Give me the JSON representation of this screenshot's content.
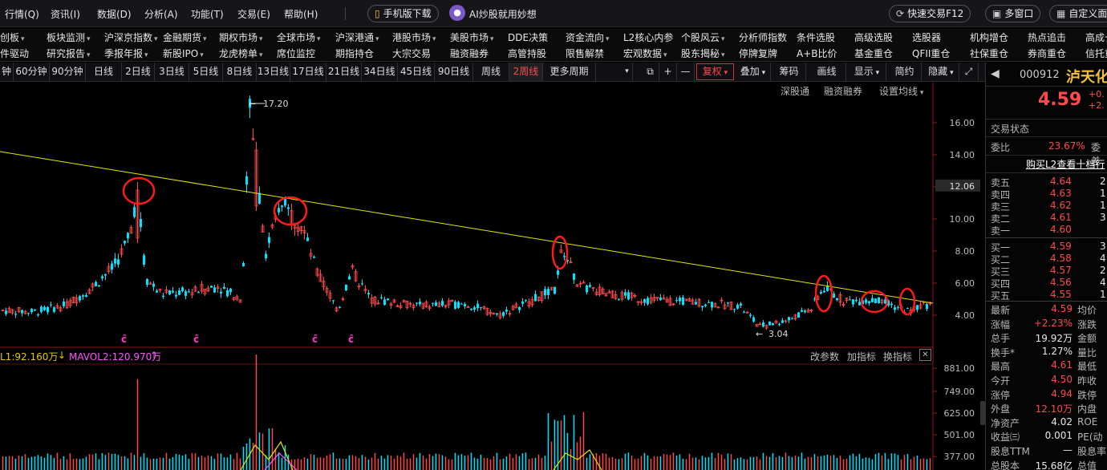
{
  "menu": {
    "items": [
      "行情(Q)",
      "资讯(I)",
      "数据(D)",
      "分析(A)",
      "功能(T)",
      "交易(E)",
      "帮助(H)"
    ],
    "mobile_download": "手机版下载",
    "ai_promo": "AI炒股就用妙想",
    "quick_trade": "快速交易F12",
    "multi_window": "多窗口",
    "custom": "自定义面"
  },
  "modules": {
    "row1": [
      "创板",
      "板块监测",
      "沪深京指数",
      "金融期货",
      "期权市场",
      "全球市场",
      "沪深港通",
      "港股市场",
      "美股市场",
      "DDE决策",
      "资金流向",
      "L2核心内参",
      "个股风云",
      "分析师指数",
      "条件选股",
      "高级选股",
      "选股器",
      "机构增仓",
      "热点追击",
      "高成长"
    ],
    "row2": [
      "件驱动",
      "研究报告",
      "季报年报",
      "新股IPO",
      "龙虎榜单",
      "席位监控",
      "期指持仓",
      "大宗交易",
      "融资融券",
      "高管持股",
      "限售解禁",
      "宏观数据",
      "股东揭秘",
      "停牌复牌",
      "A+B比价",
      "基金重仓",
      "QFII重仓",
      "社保重仓",
      "券商重仓",
      "信托重"
    ]
  },
  "periods": [
    "钟",
    "60分钟",
    "90分钟",
    "日线",
    "2日线",
    "3日线",
    "5日线",
    "8日线",
    "13日线",
    "17日线",
    "21日线",
    "34日线",
    "45日线",
    "90日线",
    "周线",
    "2周线",
    "更多周期"
  ],
  "active_period": "2周线",
  "toolbar": {
    "plus": "+",
    "minus": "—",
    "fuquan": "复权",
    "overlay": "叠加",
    "chips": "筹码",
    "draw": "画线",
    "display": "显示",
    "simple": "简约",
    "hide": "隐藏"
  },
  "chart_links": {
    "shentong": "深股通",
    "rzrq": "融资融券",
    "ma_setting": "设置均线"
  },
  "chart_data": {
    "type": "candlestick",
    "y_ticks": [
      "16.00",
      "14.00",
      "12.00",
      "10.00",
      "8.00",
      "6.00",
      "4.00"
    ],
    "ylim": [
      3.0,
      17.5
    ],
    "current_price_tag": "12.06",
    "high_label": "17.20",
    "low_label": "3.04",
    "trendline_color": "#e6e600",
    "up_color": "#ff4a4a",
    "down_color": "#00e5ff",
    "marker_text": "ĉ",
    "volume_ticks": [
      "881.00",
      "749.00",
      "625.00",
      "501.00",
      "377.00"
    ],
    "volume_ylim": [
      300,
      900
    ]
  },
  "indicator": {
    "vol1": "L1:92.160万",
    "vol1_arrow": "↓",
    "mavol2": "MAVOL2:120.970万",
    "mavol2_arrow": "↑",
    "change_param": "改参数",
    "add_indicator": "加指标",
    "swap_indicator": "换指标",
    "close": "✕"
  },
  "quote": {
    "code": "000912",
    "name": "泸天化",
    "price": "4.59",
    "change": "+0.",
    "change_pct": "+2.",
    "status_label": "交易状态",
    "weibi_label": "委比",
    "weibi_value": "23.67%",
    "weicha_label": "委差",
    "l2_promo": "购买L2查看十档行",
    "asks": [
      {
        "label": "卖五",
        "price": "4.64",
        "vol": "2"
      },
      {
        "label": "卖四",
        "price": "4.63",
        "vol": "1"
      },
      {
        "label": "卖三",
        "price": "4.62",
        "vol": "1"
      },
      {
        "label": "卖二",
        "price": "4.61",
        "vol": "3"
      },
      {
        "label": "卖一",
        "price": "4.60",
        "vol": ""
      }
    ],
    "bids": [
      {
        "label": "买一",
        "price": "4.59",
        "vol": "3"
      },
      {
        "label": "买二",
        "price": "4.58",
        "vol": "4"
      },
      {
        "label": "买三",
        "price": "4.57",
        "vol": "2"
      },
      {
        "label": "买四",
        "price": "4.56",
        "vol": "4"
      },
      {
        "label": "买五",
        "price": "4.55",
        "vol": "1"
      }
    ],
    "stats": [
      {
        "l": "最新",
        "v": "4.59",
        "vc": "red",
        "r": "均价"
      },
      {
        "l": "涨幅",
        "v": "+2.23%",
        "vc": "red",
        "r": "涨跌"
      },
      {
        "l": "总手",
        "v": "19.92万",
        "vc": "wht",
        "r": "金额"
      },
      {
        "l": "换手*",
        "v": "1.27%",
        "vc": "wht",
        "r": "量比"
      },
      {
        "l": "最高",
        "v": "4.61",
        "vc": "red",
        "r": "最低"
      },
      {
        "l": "今开",
        "v": "4.50",
        "vc": "red",
        "r": "昨收"
      },
      {
        "l": "涨停",
        "v": "4.94",
        "vc": "red",
        "r": "跌停"
      },
      {
        "l": "外盘",
        "v": "12.10万",
        "vc": "red",
        "r": "内盘"
      },
      {
        "l": "净资产",
        "v": "4.02",
        "vc": "wht",
        "r": "ROE"
      },
      {
        "l": "收益㈢",
        "v": "0.001",
        "vc": "wht",
        "r": "PE(动"
      },
      {
        "l": "股息TTM",
        "v": "—",
        "vc": "wht",
        "r": "股息率"
      },
      {
        "l": "总股本",
        "v": "15.68亿",
        "vc": "wht",
        "r": "总值"
      }
    ]
  }
}
